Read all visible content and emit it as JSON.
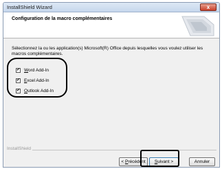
{
  "window": {
    "title": "InstallShield Wizard",
    "close_symbol": "x"
  },
  "header": {
    "title": "Configuration de la macro complémentaires"
  },
  "body": {
    "description": "Sélectionnez la ou les application(s) Microsoft(R) Office depuis lesquelles vous voulez utiliser les macros complémentaires.",
    "checkbox_mark": "✔",
    "addins": [
      {
        "prefix": "",
        "accel": "W",
        "rest": "ord Add-In",
        "checked": true
      },
      {
        "prefix": "",
        "accel": "E",
        "rest": "xcel Add-In",
        "checked": true
      },
      {
        "prefix": "",
        "accel": "O",
        "rest": "utlook Add-In",
        "checked": true
      }
    ]
  },
  "footer": {
    "brand": "InstallShield",
    "buttons": {
      "prev": {
        "pre": "< ",
        "accel": "P",
        "rest": "récédent"
      },
      "next": {
        "pre": "",
        "accel": "S",
        "rest": "uivant >"
      },
      "cancel": "Annuler"
    }
  },
  "colors": {
    "accent_border": "#3c7fb1",
    "close_red": "#c9402a"
  }
}
